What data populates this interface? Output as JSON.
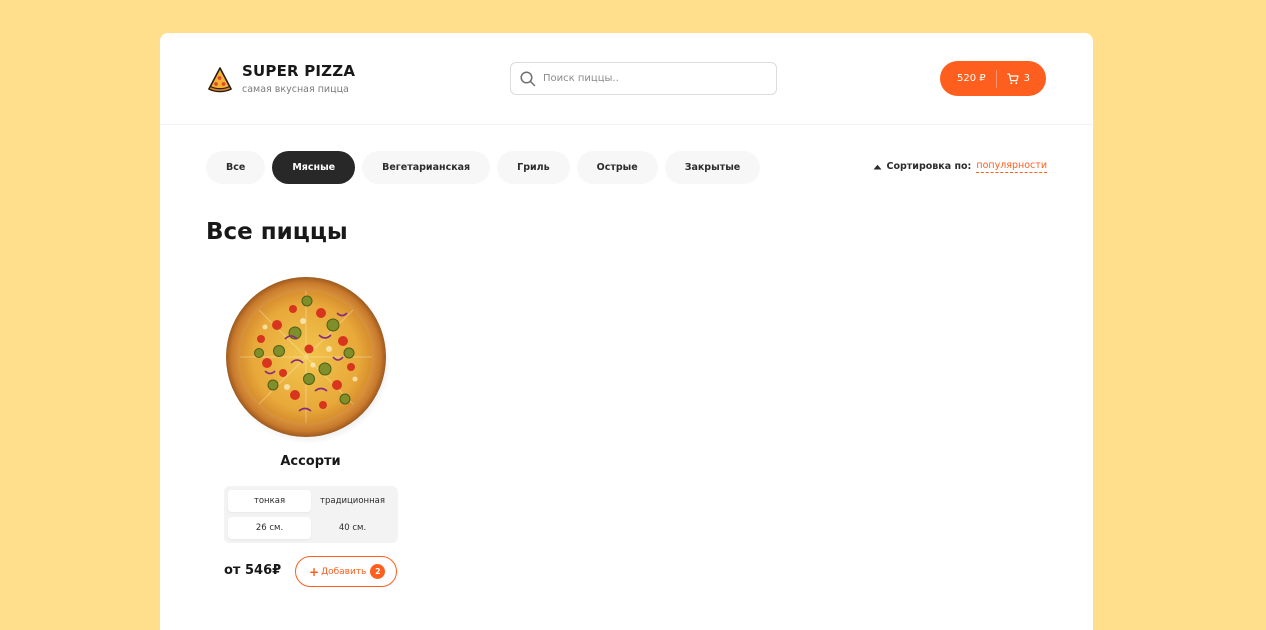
{
  "colors": {
    "accent": "#fe5f1e",
    "background": "#ffdf8c",
    "dark": "#282828"
  },
  "header": {
    "title": "SUPER PIZZA",
    "subtitle": "самая вкусная пицца",
    "logo_icon": "pizza-slice-icon"
  },
  "search": {
    "placeholder": "Поиск пиццы..",
    "value": "",
    "icon": "search-icon"
  },
  "cart": {
    "price": "520 ₽",
    "count": "3",
    "icon": "cart-icon"
  },
  "categories": {
    "items": [
      {
        "label": "Все"
      },
      {
        "label": "Мясные",
        "active": true
      },
      {
        "label": "Вегетарианская"
      },
      {
        "label": "Гриль"
      },
      {
        "label": "Острые"
      },
      {
        "label": "Закрытые"
      }
    ]
  },
  "sort": {
    "label": "Сортировка по:",
    "value": "популярности",
    "icon": "arrow-up-icon"
  },
  "main": {
    "title": "Все пиццы"
  },
  "pizzas": [
    {
      "name": "Ассорти",
      "types": [
        "тонкая",
        "традиционная"
      ],
      "selected_type": "тонкая",
      "sizes": [
        "26 см.",
        "40 см."
      ],
      "selected_size": "26 см.",
      "price": "от 546₽",
      "add_label": "Добавить",
      "add_count": "2"
    }
  ]
}
